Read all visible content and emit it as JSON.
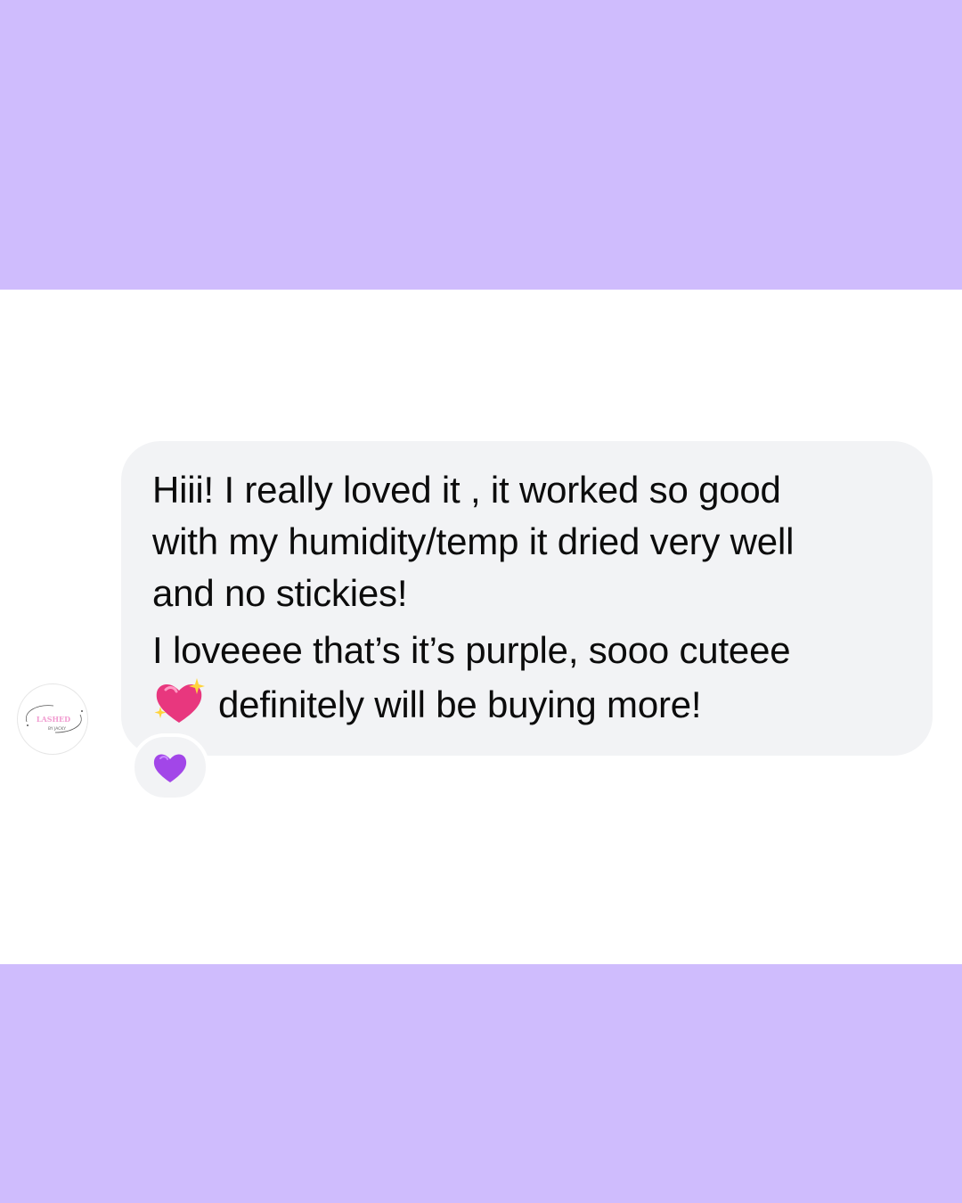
{
  "theme": {
    "band_color": "#cfbcfd",
    "bubble_color": "#f2f3f5",
    "text_color": "#0c0c0c",
    "heart_color": "#a246e8",
    "sparkle_heart_color": "#e8377e"
  },
  "avatar": {
    "logo_text": "LASHED",
    "logo_subtext": "BY JACKY"
  },
  "message": {
    "lines": [
      "Hiii! I really loved it , it worked so good",
      "with my humidity/temp it dried very well",
      "and no stickies!",
      "I loveeee that’s it’s purple, sooo cuteee",
      "definitely will be buying more!"
    ],
    "inline_emoji": "sparkling-heart-icon"
  },
  "reaction": {
    "icon": "purple-heart-icon"
  }
}
